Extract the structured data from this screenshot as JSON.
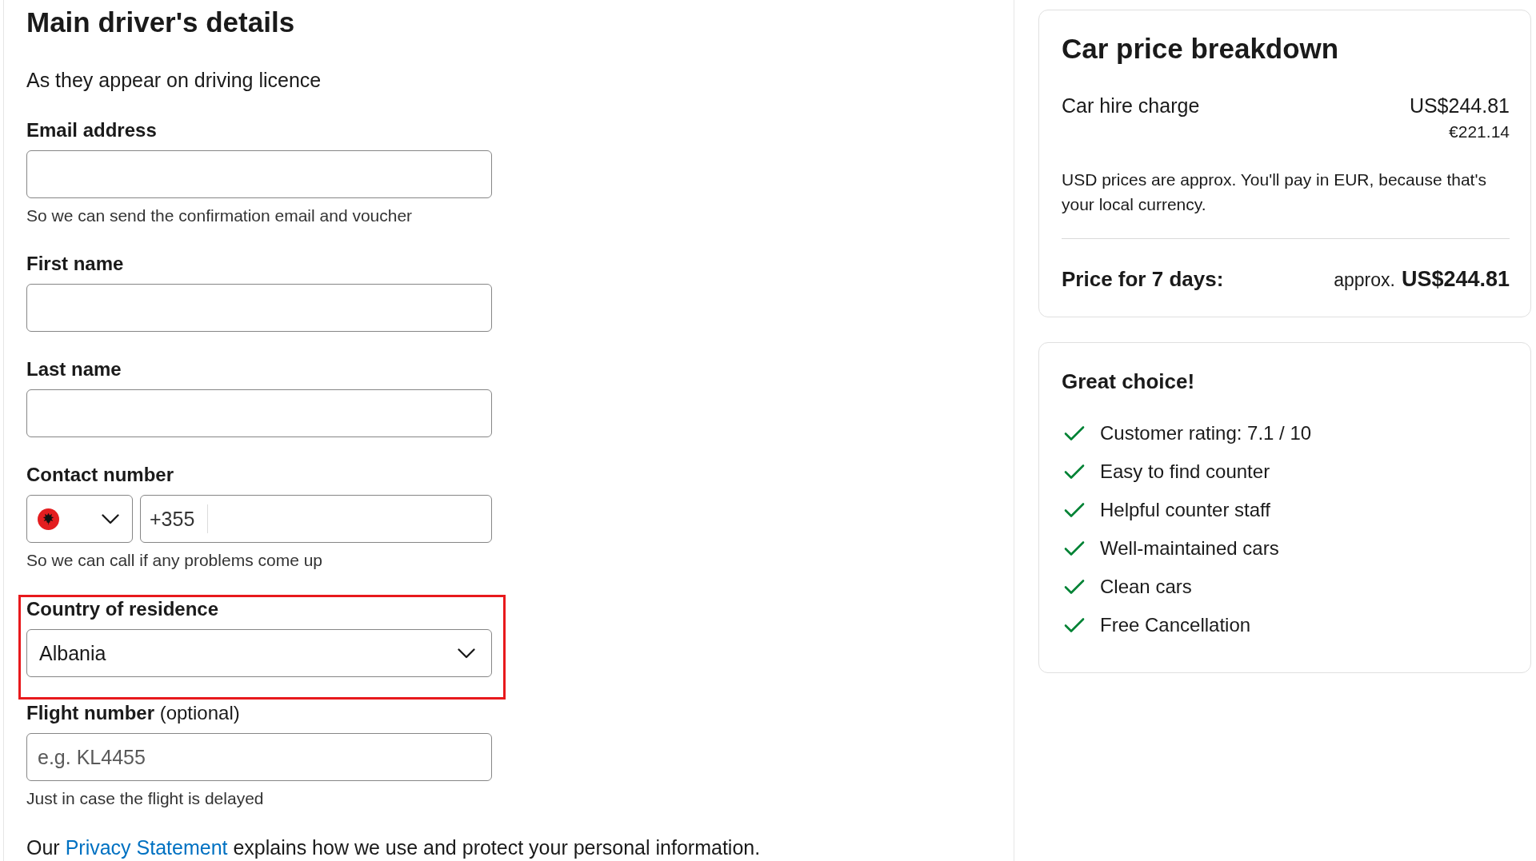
{
  "driver_form": {
    "title": "Main driver's details",
    "subtitle": "As they appear on driving licence",
    "fields": [
      {
        "kind": "text",
        "label": "Email address",
        "hint": "So we can send the confirmation email and voucher",
        "highlighted": false
      },
      {
        "kind": "text",
        "label": "First name",
        "highlighted": false
      },
      {
        "kind": "text",
        "label": "Last name",
        "highlighted": false
      },
      {
        "kind": "phone",
        "label": "Contact number",
        "dial_code": "+355",
        "hint": "So we can call if any problems come up",
        "highlighted": false
      },
      {
        "kind": "select",
        "label": "Country of residence",
        "value": "Albania",
        "highlighted": true
      },
      {
        "kind": "text",
        "label": "Flight number",
        "label_note": "(optional)",
        "placeholder": "e.g. KL4455",
        "hint": "Just in case the flight is delayed",
        "highlighted": false
      }
    ],
    "privacy_notice": {
      "before": "Our",
      "link": "Privacy Statement",
      "after": "explains how we use and protect your personal information."
    }
  },
  "price_breakdown": {
    "title": "Car price breakdown",
    "lines": [
      {
        "label": "Car hire charge",
        "amount": "US$244.81",
        "local_amount": "€221.14"
      }
    ],
    "note": "USD prices are approx. You'll pay in EUR, because that's your local currency.",
    "total": {
      "label": "Price for 7 days:",
      "prefix": "approx.",
      "amount": "US$244.81"
    }
  },
  "highlights": {
    "title": "Great choice!",
    "items": [
      "Customer rating: 7.1 / 10",
      "Easy to find counter",
      "Helpful counter staff",
      "Well-maintained cars",
      "Clean cars",
      "Free Cancellation"
    ]
  }
}
